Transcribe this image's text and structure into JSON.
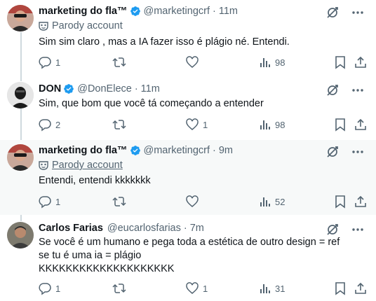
{
  "tweets": [
    {
      "name": "marketing do fla™",
      "handle": "@marketingcrf",
      "time": "11m",
      "parody_label": "Parody account",
      "lines": [
        "Sim sim claro , mas a IA fazer isso é plágio né. Entendi."
      ],
      "replies": "1",
      "retweets": "",
      "likes": "",
      "views": "98"
    },
    {
      "name": "DON",
      "handle": "@DonElece",
      "time": "11m",
      "lines": [
        "Sim, que bom que você tá começando a entender"
      ],
      "replies": "2",
      "retweets": "",
      "likes": "1",
      "views": "98"
    },
    {
      "name": "marketing do fla™",
      "handle": "@marketingcrf",
      "time": "9m",
      "parody_label": "Parody account",
      "lines": [
        "Entendi, entendi kkkkkkk"
      ],
      "replies": "1",
      "retweets": "",
      "likes": "",
      "views": "52"
    },
    {
      "name": "Carlos Farias",
      "handle": "@eucarlosfarias",
      "time": "7m",
      "lines": [
        "Se você é um humano e pega toda a estética de outro design = ref",
        "se tu é uma ia = plágio",
        "KKKKKKKKKKKKKKKKKKKK"
      ],
      "replies": "1",
      "retweets": "",
      "likes": "1",
      "views": "31"
    }
  ],
  "colors": {
    "verified": "#1d9bf0",
    "secondary_text": "#536471",
    "thread_line": "#cfd9de",
    "highlight_bg": "#f7f9f9"
  },
  "icons": {
    "verified": "verified-badge-icon",
    "parody": "parody-mask-icon",
    "grok": "grok-icon",
    "more": "more-icon",
    "reply": "reply-icon",
    "retweet": "retweet-icon",
    "like": "heart-icon",
    "views": "views-icon",
    "bookmark": "bookmark-icon",
    "share": "share-icon"
  }
}
